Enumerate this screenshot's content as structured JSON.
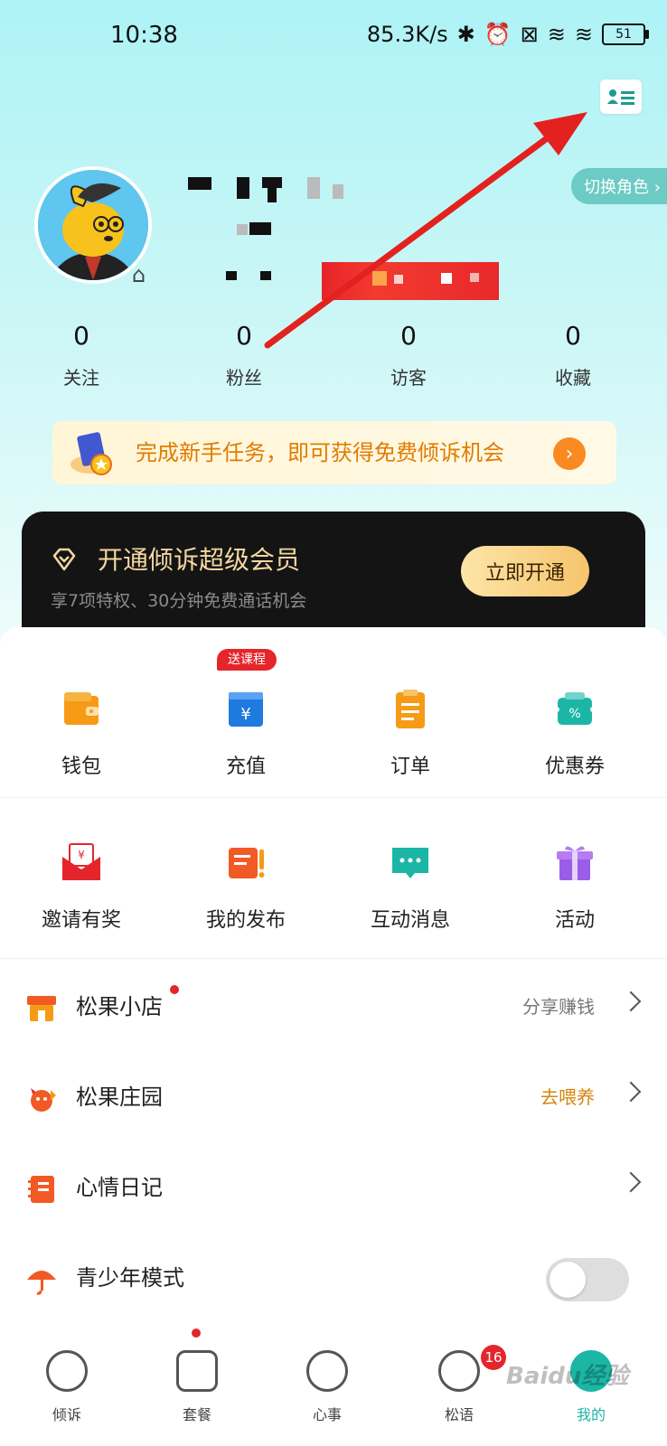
{
  "status_bar": {
    "time": "10:38",
    "net_speed": "85.3K/s",
    "battery": "51"
  },
  "header": {
    "switch_role": "切换角色 ›"
  },
  "stats": [
    {
      "value": "0",
      "label": "关注"
    },
    {
      "value": "0",
      "label": "粉丝"
    },
    {
      "value": "0",
      "label": "访客"
    },
    {
      "value": "0",
      "label": "收藏"
    }
  ],
  "task_banner": {
    "text": "完成新手任务，即可获得免费倾诉机会",
    "go": "›"
  },
  "vip": {
    "title": "开通倾诉超级会员",
    "subtitle": "享7项特权、30分钟免费通话机会",
    "button": "立即开通"
  },
  "grid": {
    "promo_tag": "送课程",
    "row1": [
      {
        "label": "钱包",
        "icon": "wallet-icon"
      },
      {
        "label": "充值",
        "icon": "recharge-icon"
      },
      {
        "label": "订单",
        "icon": "order-icon"
      },
      {
        "label": "优惠券",
        "icon": "coupon-icon"
      }
    ],
    "row2": [
      {
        "label": "邀请有奖",
        "icon": "invite-icon"
      },
      {
        "label": "我的发布",
        "icon": "publish-icon"
      },
      {
        "label": "互动消息",
        "icon": "message-icon"
      },
      {
        "label": "活动",
        "icon": "gift-icon"
      }
    ]
  },
  "list": [
    {
      "title": "松果小店",
      "right": "分享赚钱"
    },
    {
      "title": "松果庄园",
      "right": "去喂养"
    },
    {
      "title": "心情日记",
      "right": ""
    },
    {
      "title": "青少年模式",
      "right": ""
    }
  ],
  "tabbar": [
    {
      "label": "倾诉"
    },
    {
      "label": "套餐"
    },
    {
      "label": "心事"
    },
    {
      "label": "松语"
    },
    {
      "label": "我的"
    }
  ],
  "tab_badge": "16",
  "watermark": "Baidu经验",
  "colors": {
    "accent": "#1cb6a7",
    "orange": "#f98a22",
    "red": "#e4262c",
    "vip_gold": "#f5d7a0"
  }
}
